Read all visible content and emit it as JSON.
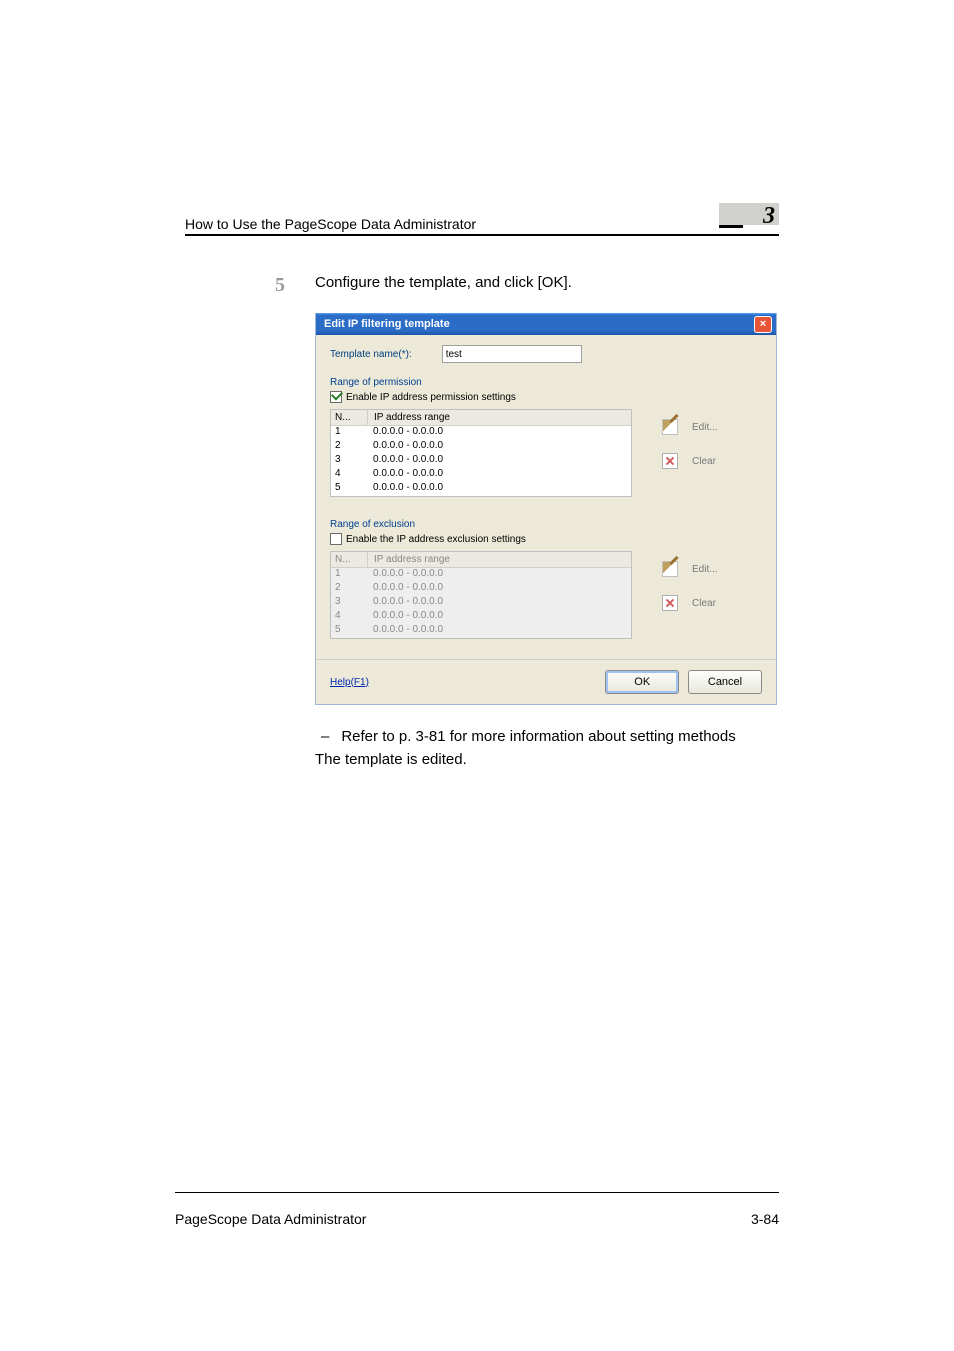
{
  "header": {
    "title": "How to Use the PageScope Data Administrator",
    "chapter_number": "3"
  },
  "step": {
    "number": "5",
    "text": "Configure the template, and click [OK]."
  },
  "dialog": {
    "title": "Edit IP filtering template",
    "close_char": "×",
    "template_name_label": "Template name(*):",
    "template_name_value": "test",
    "permission": {
      "section_title": "Range of permission",
      "checkbox_label": "Enable IP address permission settings",
      "checked": true,
      "col_n": "N...",
      "col_ip": "IP address range",
      "rows": [
        {
          "n": "1",
          "ip": "0.0.0.0 - 0.0.0.0"
        },
        {
          "n": "2",
          "ip": "0.0.0.0 - 0.0.0.0"
        },
        {
          "n": "3",
          "ip": "0.0.0.0 - 0.0.0.0"
        },
        {
          "n": "4",
          "ip": "0.0.0.0 - 0.0.0.0"
        },
        {
          "n": "5",
          "ip": "0.0.0.0 - 0.0.0.0"
        }
      ],
      "edit_label": "Edit...",
      "clear_label": "Clear"
    },
    "exclusion": {
      "section_title": "Range of exclusion",
      "checkbox_label": "Enable the IP address exclusion settings",
      "checked": false,
      "col_n": "N...",
      "col_ip": "IP address range",
      "rows": [
        {
          "n": "1",
          "ip": "0.0.0.0 - 0.0.0.0"
        },
        {
          "n": "2",
          "ip": "0.0.0.0 - 0.0.0.0"
        },
        {
          "n": "3",
          "ip": "0.0.0.0 - 0.0.0.0"
        },
        {
          "n": "4",
          "ip": "0.0.0.0 - 0.0.0.0"
        },
        {
          "n": "5",
          "ip": "0.0.0.0 - 0.0.0.0"
        }
      ],
      "edit_label": "Edit...",
      "clear_label": "Clear"
    },
    "help_label": "Help(F1)",
    "ok_label": "OK",
    "cancel_label": "Cancel"
  },
  "after": {
    "bullet": "–",
    "line1": "Refer to p. 3-81 for more information about setting methods",
    "line2": "The template is edited."
  },
  "footer": {
    "left": "PageScope Data Administrator",
    "right": "3-84"
  }
}
